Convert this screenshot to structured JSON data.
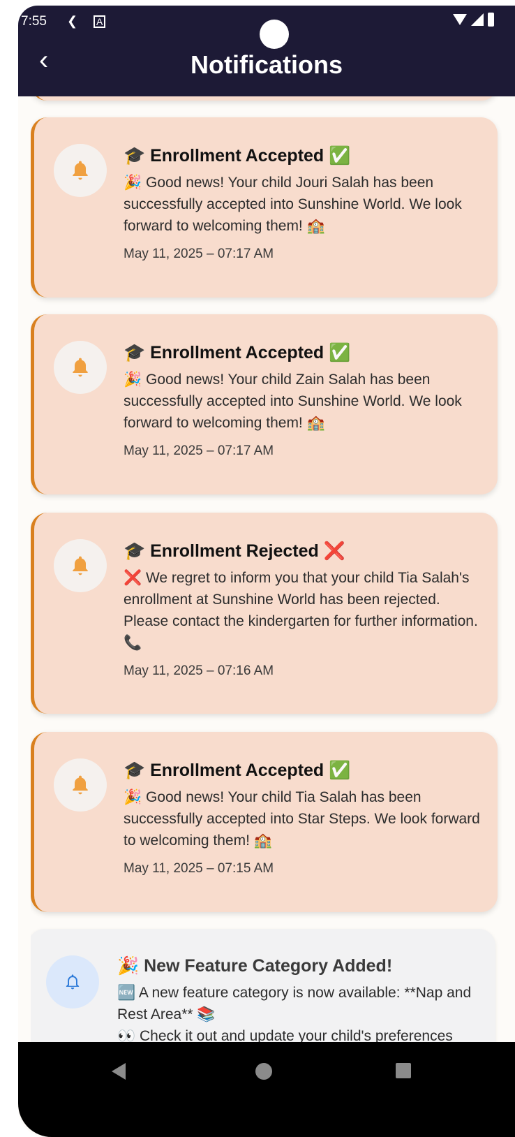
{
  "status_bar": {
    "time": "7:55",
    "icons": [
      "usb-debug-icon",
      "notification-a-icon",
      "wifi-icon",
      "cell-signal-icon",
      "battery-icon"
    ]
  },
  "header": {
    "title": "Notifications",
    "back_icon": "chevron-left-icon",
    "background": "#1d1a36"
  },
  "colors": {
    "card_bg": "#f8dccd",
    "card_accent": "#d9801f",
    "system_card_bg": "#f2f2f3",
    "bell_orange": "#f0a040",
    "bell_blue": "#2a78d8"
  },
  "notifications": [
    {
      "title": "🎓 Enrollment Accepted ✅",
      "body": "🎉 Good news! Your child Jouri Salah has been successfully accepted into Sunshine World. We look forward to welcoming them! 🏫",
      "date": "May 11, 2025 – 07:17 AM",
      "icon": "bell-icon"
    },
    {
      "title": "🎓 Enrollment Accepted ✅",
      "body": "🎉 Good news! Your child Zain Salah has been successfully accepted into Sunshine World. We look forward to welcoming them! 🏫",
      "date": "May 11, 2025 – 07:17 AM",
      "icon": "bell-icon"
    },
    {
      "title": "🎓 Enrollment Rejected ❌",
      "body": "❌ We regret to inform you that your child Tia Salah's enrollment at Sunshine World has been rejected. Please contact the kindergarten for further information. 📞",
      "date": "May 11, 2025 – 07:16 AM",
      "icon": "bell-icon"
    },
    {
      "title": "🎓 Enrollment Accepted ✅",
      "body": "🎉 Good news! Your child Tia Salah has been successfully accepted into Star Steps. We look forward to welcoming them! 🏫",
      "date": "May 11, 2025 – 07:15 AM",
      "icon": "bell-icon"
    },
    {
      "title": "🎉 New Feature Category Added!",
      "body": "🆕 A new feature category is now available: **Nap and Rest Area** 📚",
      "body2": "👀 Check it out and update your child's preferences",
      "icon": "bell-outline-icon"
    }
  ],
  "nav_bar": {
    "buttons": [
      "back-triangle-icon",
      "home-circle-icon",
      "recents-square-icon"
    ]
  }
}
